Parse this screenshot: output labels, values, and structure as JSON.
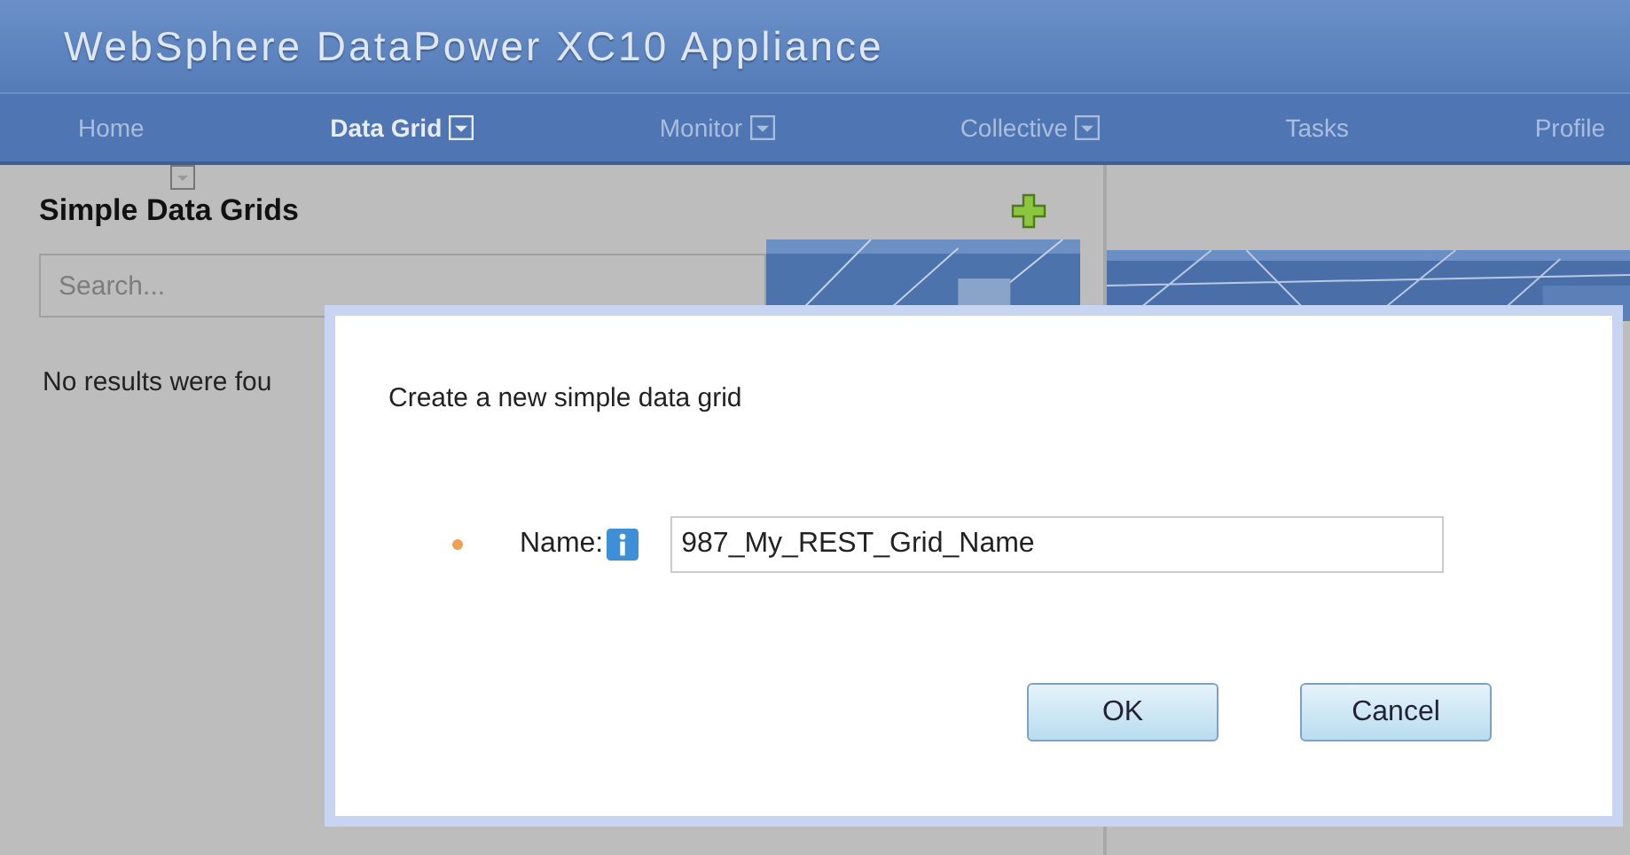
{
  "header": {
    "title": "WebSphere DataPower XC10 Appliance"
  },
  "nav": [
    {
      "label": "Home",
      "selected": false,
      "has_menu": false
    },
    {
      "label": "Data Grid",
      "selected": true,
      "has_menu": true
    },
    {
      "label": "Monitor",
      "selected": false,
      "has_menu": true
    },
    {
      "label": "Collective",
      "selected": false,
      "has_menu": true
    },
    {
      "label": "Tasks",
      "selected": false,
      "has_menu": false
    },
    {
      "label": "Profile",
      "selected": false,
      "has_menu": false
    }
  ],
  "panel": {
    "title": "Simple Data Grids",
    "search": {
      "placeholder": "Search..."
    },
    "message": "No results were fou"
  },
  "dialog": {
    "heading": "Create a new simple data grid",
    "field": {
      "label": "Name:",
      "required": true,
      "value": "987_My_REST_Grid_Name"
    },
    "buttons": [
      "OK",
      "Cancel"
    ]
  }
}
